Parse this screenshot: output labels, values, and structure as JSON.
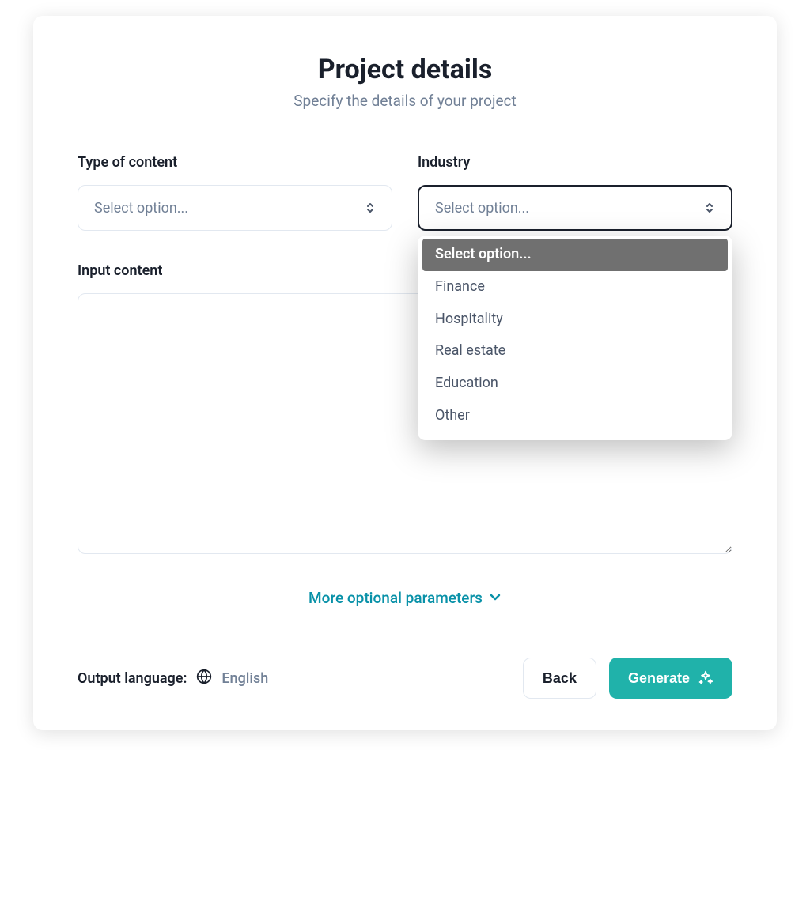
{
  "header": {
    "title": "Project details",
    "subtitle": "Specify the details of your project"
  },
  "fields": {
    "content_type": {
      "label": "Type of content",
      "placeholder": "Select option..."
    },
    "industry": {
      "label": "Industry",
      "placeholder": "Select option...",
      "options": [
        "Select option...",
        "Finance",
        "Hospitality",
        "Real estate",
        "Education",
        "Other"
      ]
    },
    "input_content": {
      "label": "Input content",
      "value": ""
    }
  },
  "more_params": {
    "label": "More optional parameters"
  },
  "output_language": {
    "label": "Output language:",
    "value": "English"
  },
  "buttons": {
    "back": "Back",
    "generate": "Generate"
  },
  "colors": {
    "accent": "#20b2aa",
    "link": "#0891a8",
    "text_dark": "#1a202c",
    "text_muted": "#718096"
  }
}
